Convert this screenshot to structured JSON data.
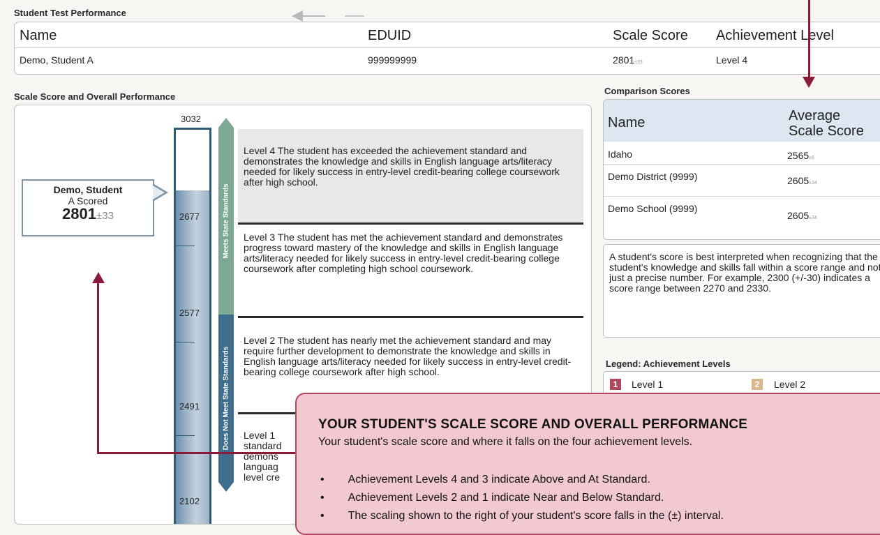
{
  "student_test_performance": {
    "title": "Student Test Performance",
    "headers": {
      "name": "Name",
      "eduid": "EDUID",
      "scale_score": "Scale Score",
      "achievement_level": "Achievement Level"
    },
    "row": {
      "name": "Demo, Student A",
      "eduid": "999999999",
      "scale_score": "2801",
      "scale_score_pm": "±33",
      "achievement_level": "Level 4"
    }
  },
  "scale_section": {
    "title": "Scale Score and Overall Performance",
    "ticks": [
      "3032",
      "2677",
      "2577",
      "2491",
      "2102"
    ],
    "callout": {
      "line1": "Demo, Student",
      "line2": "A Scored",
      "score": "2801",
      "pm": "±33"
    },
    "side_labels": {
      "meets": "Meets State Standards",
      "not_meets": "Does Not Meet State Standards"
    },
    "levels": [
      {
        "label": "Level 4",
        "text": "The student has exceeded the achievement standard and demonstrates the knowledge and skills in English language arts/literacy needed for likely success in entry-level credit-bearing college coursework after high school."
      },
      {
        "label": "Level 3",
        "text": "The student has met the achievement standard and demonstrates progress toward mastery of the knowledge and skills in English language arts/literacy needed for likely success in entry-level credit-bearing college coursework after completing high school coursework."
      },
      {
        "label": "Level 2",
        "text": "The student has nearly met the achievement standard and may require further development to demonstrate the knowledge and skills in English language arts/literacy needed for likely success in entry-level credit-bearing college coursework after high school."
      },
      {
        "label": "Level 1",
        "lines": [
          "standard",
          "demons",
          "languag",
          "level cre"
        ]
      }
    ]
  },
  "comparison": {
    "title": "Comparison Scores",
    "headers": {
      "name": "Name",
      "avg_line1": "Average",
      "avg_line2": "Scale Score"
    },
    "rows": [
      {
        "name": "Idaho",
        "score": "2565",
        "pm": "±6"
      },
      {
        "name": "Demo District (9999)",
        "score": "2605",
        "pm": "±34"
      },
      {
        "name": "Demo School (9999)",
        "score": "2605",
        "pm": "±34"
      }
    ]
  },
  "note": "A student's score is best interpreted when recognizing that the student's knowledge and skills fall within a score range and not just a precise number. For example, 2300 (+/-30) indicates a score range between 2270 and 2330.",
  "legend": {
    "title": "Legend: Achievement Levels",
    "items": [
      {
        "num": "1",
        "label": "Level 1",
        "color": "#b0485f"
      },
      {
        "num": "2",
        "label": "Level 2",
        "color": "#d9b98c"
      }
    ]
  },
  "overlay": {
    "title": "YOUR STUDENT'S SCALE SCORE AND OVERALL PERFORMANCE",
    "subtitle": "Your student's scale score and where it falls on the four achievement levels.",
    "bullets": [
      "Achievement Levels 4 and 3 indicate Above and At Standard.",
      "Achievement Levels 2 and 1 indicate Near and Below Standard.",
      "The scaling shown to the right of your student's score falls in the (±) interval."
    ]
  },
  "colors": {
    "annotation": "#8a1a3a",
    "overlay_bg": "#f2c9d0",
    "meets": "#7da894",
    "not_meets": "#3f6e8c"
  }
}
